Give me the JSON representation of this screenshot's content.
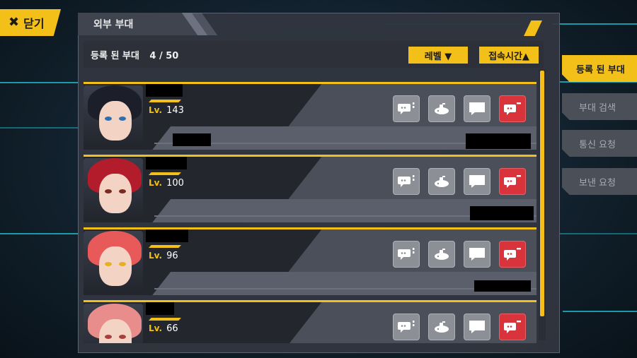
{
  "close_label": "닫기",
  "panel_title": "외부 부대",
  "list_header": {
    "title": "등록 된 부대",
    "count": "4 / 50"
  },
  "sort_buttons": [
    {
      "label": "레벨 ▼"
    },
    {
      "label": "접속시간▲"
    }
  ],
  "side_tabs": [
    {
      "label": "등록 된 부대",
      "active": true
    },
    {
      "label": "부대 검색",
      "active": false
    },
    {
      "label": "통신 요청",
      "active": false
    },
    {
      "label": "보낸 요청",
      "active": false
    }
  ],
  "friends": [
    {
      "lv_label": "Lv.",
      "level": "143",
      "hair": "#1c1e2a",
      "eye": "#2f6fb0"
    },
    {
      "lv_label": "Lv.",
      "level": "100",
      "hair": "#b31c2a",
      "eye": "#7a2a20"
    },
    {
      "lv_label": "Lv.",
      "level": "96",
      "hair": "#e85a5a",
      "eye": "#e6b020"
    },
    {
      "lv_label": "Lv.",
      "level": "66",
      "hair": "#e98c8c",
      "eye": "#a84040"
    }
  ],
  "colors": {
    "accent": "#f2c018",
    "danger": "#d9343b",
    "cyan": "#1fc6d6"
  }
}
